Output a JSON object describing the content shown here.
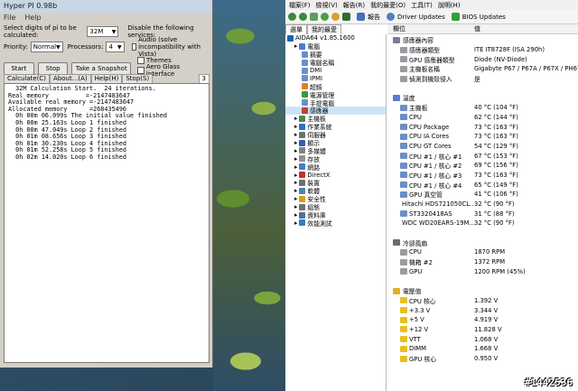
{
  "hyperpi": {
    "title": "Hyper PI 0.98b",
    "menu": [
      "File",
      "Help"
    ],
    "digits_label": "Select digits of pi to be calculated:",
    "digits_value": "32M",
    "priority_label": "Priority:",
    "priority_value": "Normal",
    "processors_label": "Processors:",
    "processors_value": "4",
    "disable_label": "Disable the following services:",
    "checks": [
      "Audio (solve incompatibility with Vista)",
      "Themes",
      "Aero Glass Interface"
    ],
    "buttons": {
      "start": "Start",
      "stop": "Stop",
      "snapshot": "Take a Snapshot"
    },
    "tabs": [
      "Calculate(C)",
      "About...(A)",
      "Help(H)",
      "Stop(S)"
    ],
    "tab_counter": "3",
    "log": [
      "  32M Calculation Start.  24 iterations.",
      "Real memory          =-2147483647",
      "Available real memory =-2147483647",
      "Allocated memory      =268435496",
      "  0h 00m 06.099s The initial value finished",
      "  0h 00m 25.163s Loop 1 finished",
      "  0h 00m 47.049s Loop 2 finished",
      "  0h 01m 08.656s Loop 3 finished",
      "  0h 01m 30.230s Loop 4 finished",
      "  0h 01m 52.258s Loop 5 finished",
      "  0h 02m 14.020s Loop 6 finished"
    ]
  },
  "aida": {
    "menu": [
      "檔案(F)",
      "檢視(V)",
      "報告(R)",
      "我的最愛(O)",
      "工具(T)",
      "說明(H)"
    ],
    "toolbar": {
      "report": "報告",
      "driver": "Driver Updates",
      "bios": "BIOS Updates"
    },
    "tabs": [
      "選單",
      "我的最愛"
    ],
    "columns": [
      "欄位",
      "值"
    ],
    "tree": [
      {
        "label": "AIDA64 v1.85.1600",
        "indent": 0,
        "color": "#1a5fb4"
      },
      {
        "label": "電腦",
        "indent": 1,
        "color": "#4a7bd0"
      },
      {
        "label": "摘要",
        "indent": 2,
        "color": "#6a8fc8"
      },
      {
        "label": "電腦名稱",
        "indent": 2,
        "color": "#6a8fc8"
      },
      {
        "label": "DMI",
        "indent": 2,
        "color": "#6a8fc8"
      },
      {
        "label": "IPMI",
        "indent": 2,
        "color": "#6a8fc8"
      },
      {
        "label": "超頻",
        "indent": 2,
        "color": "#e08020"
      },
      {
        "label": "電源管理",
        "indent": 2,
        "color": "#3a9a3a"
      },
      {
        "label": "手提電腦",
        "indent": 2,
        "color": "#6a8fc8"
      },
      {
        "label": "感應器",
        "indent": 2,
        "color": "#c04040",
        "selected": true
      },
      {
        "label": "主機板",
        "indent": 1,
        "color": "#4a8a4a"
      },
      {
        "label": "作業系統",
        "indent": 1,
        "color": "#3070c0"
      },
      {
        "label": "伺服器",
        "indent": 1,
        "color": "#707070"
      },
      {
        "label": "顯示",
        "indent": 1,
        "color": "#3060b0"
      },
      {
        "label": "多媒體",
        "indent": 1,
        "color": "#808080"
      },
      {
        "label": "存放",
        "indent": 1,
        "color": "#909090"
      },
      {
        "label": "網路",
        "indent": 1,
        "color": "#4080c0"
      },
      {
        "label": "DirectX",
        "indent": 1,
        "color": "#c03030"
      },
      {
        "label": "裝置",
        "indent": 1,
        "color": "#707070"
      },
      {
        "label": "軟體",
        "indent": 1,
        "color": "#5080b0"
      },
      {
        "label": "安全性",
        "indent": 1,
        "color": "#d0a020"
      },
      {
        "label": "組態",
        "indent": 1,
        "color": "#707070"
      },
      {
        "label": "資料庫",
        "indent": 1,
        "color": "#5070a0"
      },
      {
        "label": "效能測試",
        "indent": 1,
        "color": "#3080c0"
      }
    ],
    "sensor_prop": {
      "title": "感應器內容",
      "rows": [
        {
          "field": "感應器類型",
          "value": "ITE IT8728F  (ISA 290h)"
        },
        {
          "field": "GPU 感應器類型",
          "value": "Diode  (NV-Diode)"
        },
        {
          "field": "主機板名稱",
          "value": "Gigabyte P67 / P67A / P67X / PH67"
        },
        {
          "field": "偵測到機殼侵入",
          "value": "是"
        }
      ]
    },
    "temps": {
      "title": "溫度",
      "rows": [
        {
          "field": "主機板",
          "value": "40 °C  (104 °F)"
        },
        {
          "field": "CPU",
          "value": "62 °C  (144 °F)"
        },
        {
          "field": "CPU Package",
          "value": "73 °C  (163 °F)"
        },
        {
          "field": "CPU IA Cores",
          "value": "73 °C  (163 °F)"
        },
        {
          "field": "CPU GT Cores",
          "value": "54 °C  (129 °F)"
        },
        {
          "field": "CPU #1 / 核心 #1",
          "value": "67 °C  (153 °F)"
        },
        {
          "field": "CPU #1 / 核心 #2",
          "value": "69 °C  (156 °F)"
        },
        {
          "field": "CPU #1 / 核心 #3",
          "value": "73 °C  (163 °F)"
        },
        {
          "field": "CPU #1 / 核心 #4",
          "value": "65 °C  (149 °F)"
        },
        {
          "field": "GPU 真空管",
          "value": "41 °C  (106 °F)"
        },
        {
          "field": "Hitachi HDS721050CL...",
          "value": "32 °C  (90 °F)"
        },
        {
          "field": "ST3320418AS",
          "value": "31 °C  (88 °F)"
        },
        {
          "field": "WDC WD20EARS-19M...",
          "value": "32 °C  (90 °F)"
        }
      ]
    },
    "fans": {
      "title": "冷卻風扇",
      "rows": [
        {
          "field": "CPU",
          "value": "1870 RPM"
        },
        {
          "field": "機箱 #2",
          "value": "1372 RPM"
        },
        {
          "field": "GPU",
          "value": "1200 RPM  (45%)"
        }
      ]
    },
    "volts": {
      "title": "電壓值",
      "rows": [
        {
          "field": "CPU 核心",
          "value": "1.392 V"
        },
        {
          "field": "+3.3 V",
          "value": "3.344 V"
        },
        {
          "field": "+5 V",
          "value": "4.919 V"
        },
        {
          "field": "+12 V",
          "value": "11.828 V"
        },
        {
          "field": "VTT",
          "value": "1.068 V"
        },
        {
          "field": "DIMM",
          "value": "1.668 V"
        },
        {
          "field": "GPU 核心",
          "value": "0.950 V"
        }
      ]
    }
  },
  "watermark": "#1442536"
}
